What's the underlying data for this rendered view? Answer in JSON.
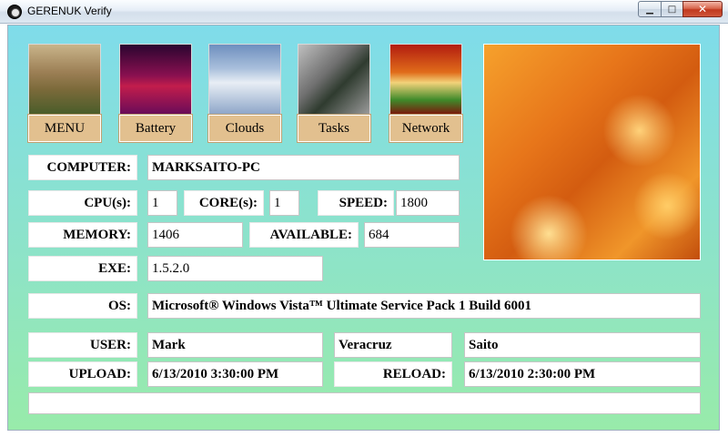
{
  "window": {
    "title": "GERENUK Verify"
  },
  "tiles": [
    {
      "label": "MENU",
      "image": "gazelle-photo"
    },
    {
      "label": "Battery",
      "image": "laser-grid-photo"
    },
    {
      "label": "Clouds",
      "image": "cloud-sky-photo"
    },
    {
      "label": "Tasks",
      "image": "circuit-board-photo"
    },
    {
      "label": "Network",
      "image": "network-grid-photo"
    }
  ],
  "info": {
    "computer": {
      "label": "COMPUTER:",
      "value": "MARKSAITO-PC"
    },
    "cpu": {
      "label": "CPU(s):",
      "value": "1"
    },
    "cores": {
      "label": "CORE(s):",
      "value": "1"
    },
    "speed": {
      "label": "SPEED:",
      "value": "1800"
    },
    "memory": {
      "label": "MEMORY:",
      "value": "1406"
    },
    "available": {
      "label": "AVAILABLE:",
      "value": "684"
    },
    "exe": {
      "label": "EXE:",
      "value": "1.5.2.0"
    },
    "os": {
      "label": "OS:",
      "value": "Microsoft® Windows Vista™ Ultimate Service Pack 1 Build 6001"
    },
    "user": {
      "label": "USER:",
      "first": "Mark",
      "middle": "Veracruz",
      "last": "Saito"
    },
    "upload": {
      "label": "UPLOAD:",
      "value": "6/13/2010 3:30:00 PM"
    },
    "reload": {
      "label": "RELOAD:",
      "value": "6/13/2010 2:30:00 PM"
    },
    "status": {
      "value": ""
    }
  },
  "colors": {
    "tile_label": "#e2c08f",
    "background_top": "#7fdcea",
    "background_bottom": "#98ebaa"
  }
}
